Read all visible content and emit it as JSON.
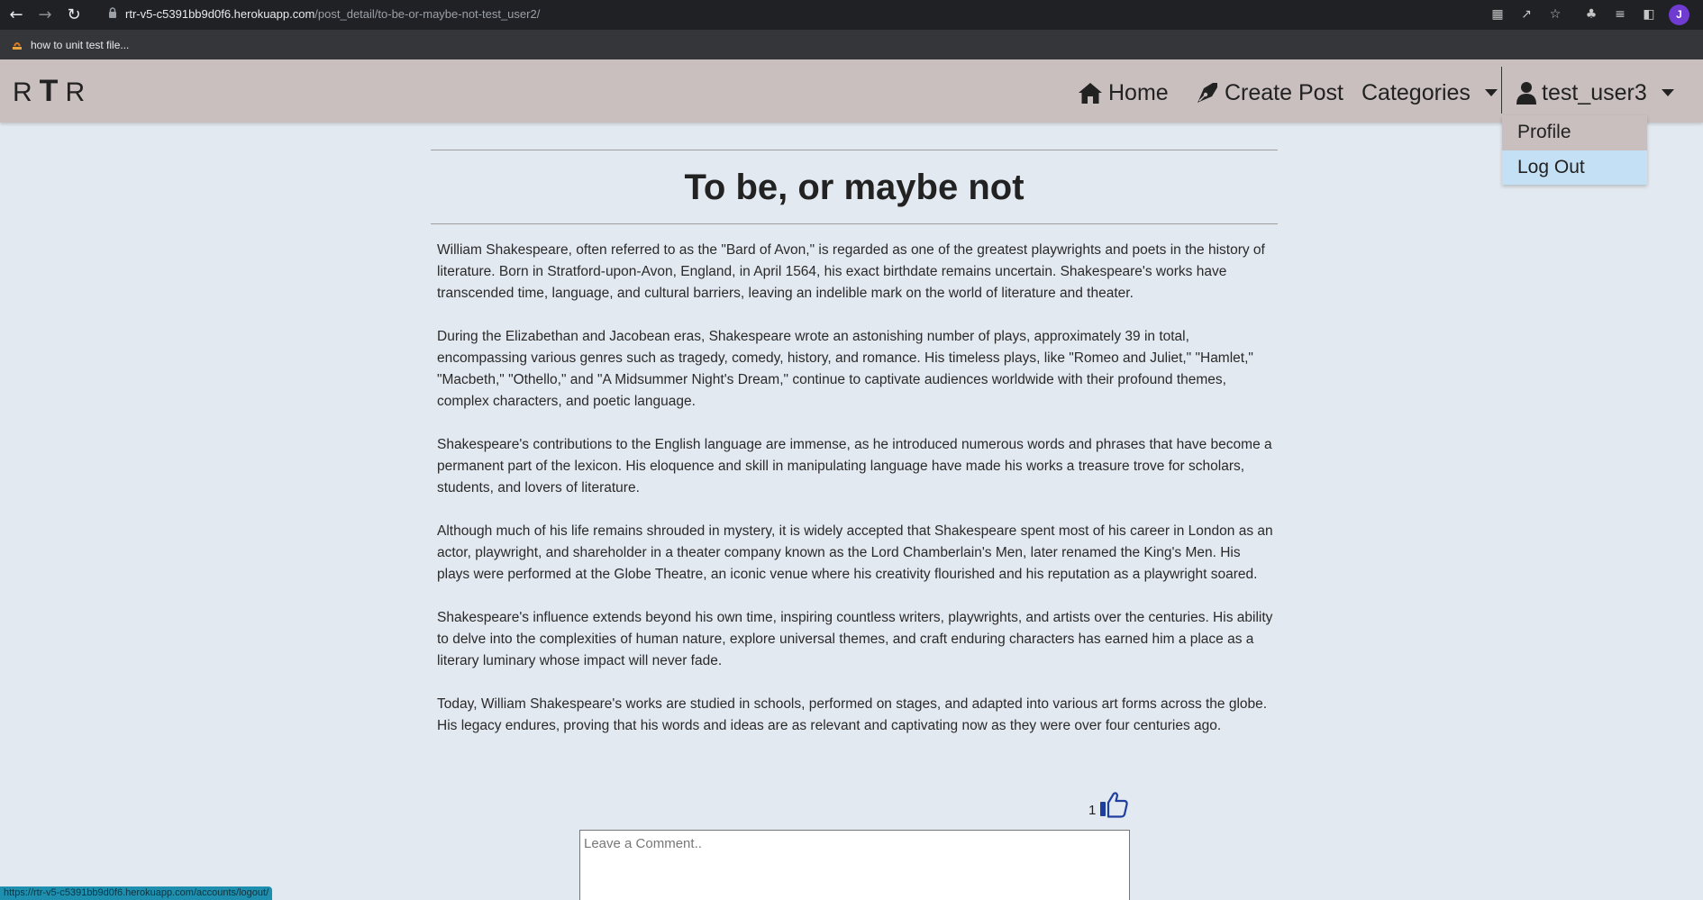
{
  "browser": {
    "url_host": "rtr-v5-c5391bb9d0f6.herokuapp.com",
    "url_path": "/post_detail/to-be-or-maybe-not-test_user2/",
    "bookmark_label": "how to unit test file...",
    "profile_initial": "J",
    "status_url": "https://rtr-v5-c5391bb9d0f6.herokuapp.com/accounts/logout/"
  },
  "navbar": {
    "brand_left": "R",
    "brand_mid": "T",
    "brand_right": "R",
    "home_label": "Home",
    "create_post_label": "Create Post",
    "categories_label": "Categories",
    "user_label": "test_user3"
  },
  "user_menu": {
    "profile_label": "Profile",
    "logout_label": "Log Out"
  },
  "post": {
    "title": "To be, or maybe not",
    "paragraphs": [
      "William Shakespeare, often referred to as the \"Bard of Avon,\" is regarded as one of the greatest playwrights and poets in the history of literature. Born in Stratford-upon-Avon, England, in April 1564, his exact birthdate remains uncertain. Shakespeare's works have transcended time, language, and cultural barriers, leaving an indelible mark on the world of literature and theater.",
      "During the Elizabethan and Jacobean eras, Shakespeare wrote an astonishing number of plays, approximately 39 in total, encompassing various genres such as tragedy, comedy, history, and romance. His timeless plays, like \"Romeo and Juliet,\" \"Hamlet,\" \"Macbeth,\" \"Othello,\" and \"A Midsummer Night's Dream,\" continue to captivate audiences worldwide with their profound themes, complex characters, and poetic language.",
      "Shakespeare's contributions to the English language are immense, as he introduced numerous words and phrases that have become a permanent part of the lexicon. His eloquence and skill in manipulating language have made his works a treasure trove for scholars, students, and lovers of literature.",
      "Although much of his life remains shrouded in mystery, it is widely accepted that Shakespeare spent most of his career in London as an actor, playwright, and shareholder in a theater company known as the Lord Chamberlain's Men, later renamed the King's Men. His plays were performed at the Globe Theatre, an iconic venue where his creativity flourished and his reputation as a playwright soared.",
      "Shakespeare's influence extends beyond his own time, inspiring countless writers, playwrights, and artists over the centuries. His ability to delve into the complexities of human nature, explore universal themes, and craft enduring characters has earned him a place as a literary luminary whose impact will never fade.",
      "Today, William Shakespeare's works are studied in schools, performed on stages, and adapted into various art forms across the globe. His legacy endures, proving that his words and ideas are as relevant and captivating now as they were over four centuries ago."
    ],
    "like_count": "1"
  },
  "comment": {
    "placeholder": "Leave a Comment.."
  },
  "colors": {
    "navbar": "#c9bfbf",
    "page_bg": "#e3e9f0",
    "like_icon": "#1f3f9e",
    "dropdown_active": "#c4e0f5"
  }
}
